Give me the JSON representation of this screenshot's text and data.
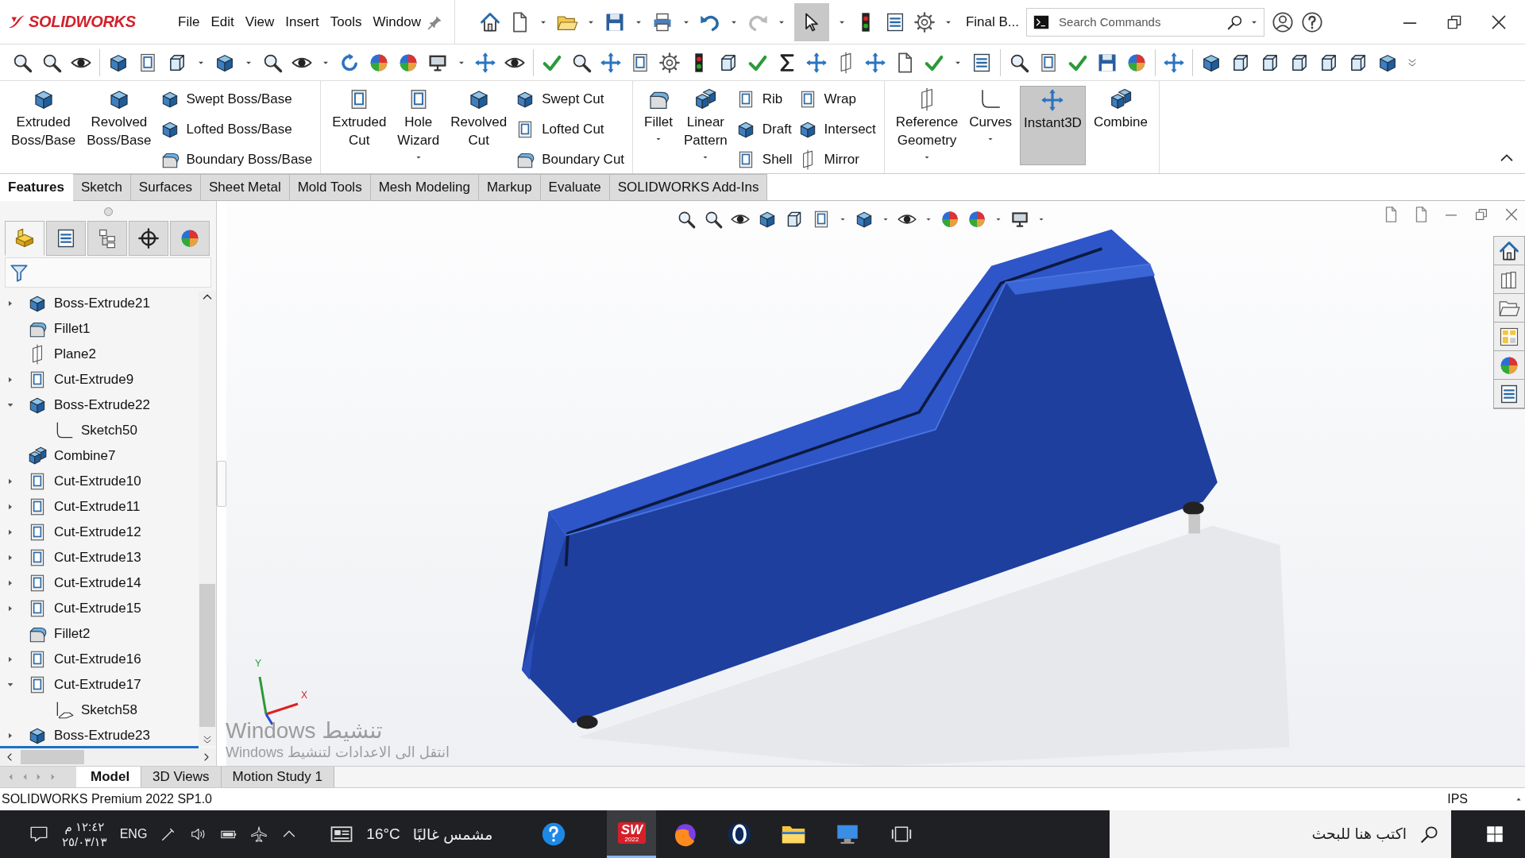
{
  "app": {
    "logo_text": "SOLIDWORKS",
    "menu": [
      "File",
      "Edit",
      "View",
      "Insert",
      "Tools",
      "Window"
    ],
    "document_title": "Final B...",
    "search": {
      "placeholder": "Search Commands"
    }
  },
  "ribbon": {
    "groups": [
      {
        "items": [
          {
            "kind": "large",
            "label": "Extruded Boss/Base",
            "dropdown": false,
            "on": false
          },
          {
            "kind": "large",
            "label": "Revolved Boss/Base",
            "dropdown": false,
            "on": false
          },
          {
            "kind": "stack",
            "items": [
              {
                "label": "Swept Boss/Base"
              },
              {
                "label": "Lofted Boss/Base"
              },
              {
                "label": "Boundary Boss/Base"
              }
            ]
          }
        ]
      },
      {
        "items": [
          {
            "kind": "large",
            "label": "Extruded Cut",
            "dropdown": false,
            "on": false
          },
          {
            "kind": "large",
            "label": "Hole Wizard",
            "dropdown": true,
            "on": false
          },
          {
            "kind": "large",
            "label": "Revolved Cut",
            "dropdown": false,
            "on": false
          },
          {
            "kind": "stack",
            "items": [
              {
                "label": "Swept Cut"
              },
              {
                "label": "Lofted Cut"
              },
              {
                "label": "Boundary Cut"
              }
            ]
          }
        ]
      },
      {
        "items": [
          {
            "kind": "large",
            "label": "Fillet",
            "dropdown": true,
            "on": false
          },
          {
            "kind": "large",
            "label": "Linear Pattern",
            "dropdown": true,
            "on": false
          },
          {
            "kind": "stack",
            "items": [
              {
                "label": "Rib"
              },
              {
                "label": "Draft"
              },
              {
                "label": "Shell"
              }
            ]
          },
          {
            "kind": "stack",
            "items": [
              {
                "label": "Wrap"
              },
              {
                "label": "Intersect"
              },
              {
                "label": "Mirror"
              }
            ]
          }
        ]
      },
      {
        "items": [
          {
            "kind": "large",
            "label": "Reference Geometry",
            "dropdown": true,
            "on": false
          },
          {
            "kind": "large",
            "label": "Curves",
            "dropdown": true,
            "on": false
          },
          {
            "kind": "large",
            "label": "Instant3D",
            "dropdown": false,
            "on": true
          },
          {
            "kind": "large",
            "label": "Combine",
            "dropdown": false,
            "on": false
          }
        ]
      }
    ]
  },
  "tabs": [
    {
      "label": "Features",
      "selected": true
    },
    {
      "label": "Sketch",
      "selected": false
    },
    {
      "label": "Surfaces",
      "selected": false
    },
    {
      "label": "Sheet Metal",
      "selected": false
    },
    {
      "label": "Mold Tools",
      "selected": false
    },
    {
      "label": "Mesh Modeling",
      "selected": false
    },
    {
      "label": "Markup",
      "selected": false
    },
    {
      "label": "Evaluate",
      "selected": false
    },
    {
      "label": "SOLIDWORKS Add-Ins",
      "selected": false
    }
  ],
  "panel": {
    "tabs": [
      {
        "selected": true
      },
      {
        "selected": false
      },
      {
        "selected": false
      },
      {
        "selected": false
      },
      {
        "selected": false
      }
    ],
    "tree": [
      {
        "label": "Boss-Extrude21",
        "kind": "boss",
        "expanded": false
      },
      {
        "label": "Fillet1",
        "kind": "fillet"
      },
      {
        "label": "Plane2",
        "kind": "plane"
      },
      {
        "label": "Cut-Extrude9",
        "kind": "cut",
        "expanded": false
      },
      {
        "label": "Boss-Extrude22",
        "kind": "boss",
        "expanded": true,
        "children": [
          {
            "label": "Sketch50",
            "kind": "sketch"
          }
        ]
      },
      {
        "label": "Combine7",
        "kind": "combine"
      },
      {
        "label": "Cut-Extrude10",
        "kind": "cut",
        "expanded": false
      },
      {
        "label": "Cut-Extrude11",
        "kind": "cut",
        "expanded": false
      },
      {
        "label": "Cut-Extrude12",
        "kind": "cut",
        "expanded": false
      },
      {
        "label": "Cut-Extrude13",
        "kind": "cut",
        "expanded": false
      },
      {
        "label": "Cut-Extrude14",
        "kind": "cut",
        "expanded": false
      },
      {
        "label": "Cut-Extrude15",
        "kind": "cut",
        "expanded": false
      },
      {
        "label": "Fillet2",
        "kind": "fillet"
      },
      {
        "label": "Cut-Extrude16",
        "kind": "cut",
        "expanded": false
      },
      {
        "label": "Cut-Extrude17",
        "kind": "cut",
        "expanded": true,
        "children": [
          {
            "label": "Sketch58",
            "kind": "shared_sketch"
          }
        ]
      },
      {
        "label": "Boss-Extrude23",
        "kind": "boss",
        "expanded": false
      }
    ]
  },
  "viewport": {
    "triad": {
      "y_label": "Y",
      "x_label": "X"
    }
  },
  "activation_notice": {
    "title": "تنشيط Windows",
    "text": "انتقل الى الاعدادات لتنشيط Windows"
  },
  "bottom_tabs": [
    {
      "label": "Model",
      "selected": true
    },
    {
      "label": "3D Views",
      "selected": false
    },
    {
      "label": "Motion Study 1",
      "selected": false
    }
  ],
  "status_bar": {
    "text": "SOLIDWORKS Premium 2022 SP1.0",
    "units": "IPS"
  },
  "taskbar": {
    "time": "١٢:٤٢ م",
    "date": "٢٥/٠٣/١٣",
    "language": "ENG",
    "temperature": "16°C",
    "weather": "مشمس غالبًا",
    "app_badge": {
      "text": "SW",
      "year": "2022"
    },
    "search": {
      "placeholder": "اكتب هنا للبحث"
    }
  }
}
